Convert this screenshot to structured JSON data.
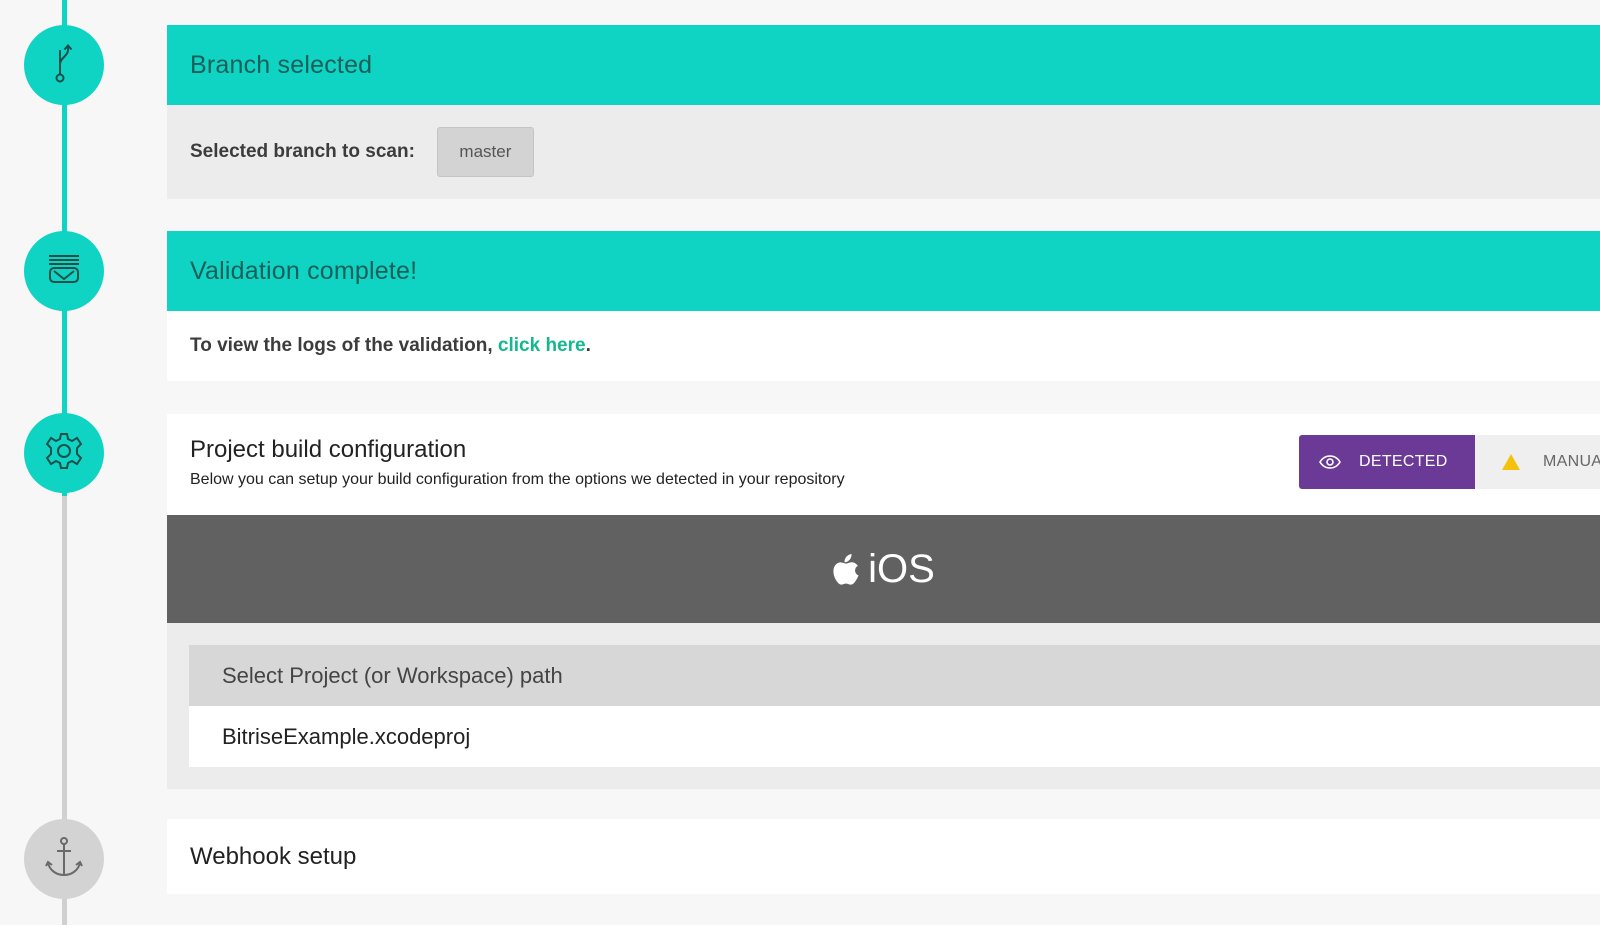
{
  "steps": {
    "branch": {
      "title": "Branch selected",
      "label": "Selected branch to scan:",
      "branch": "master"
    },
    "validation": {
      "title": "Validation complete!",
      "text_before": "To view the logs of the validation, ",
      "link": "click here",
      "text_after": "."
    },
    "config": {
      "title": "Project build configuration",
      "subtitle": "Below you can setup your build configuration from the options we detected in your repository",
      "mode_detected": "DETECTED",
      "mode_manual": "MANUAL",
      "platform": "iOS",
      "project_path_header": "Select Project (or Workspace) path",
      "project_path_option": "BitriseExample.xcodeproj"
    },
    "webhook": {
      "title": "Webhook setup"
    }
  },
  "colors": {
    "teal": "#0fd3c3",
    "purple": "#6b3a96",
    "link_green": "#13b98d",
    "ios_banner": "#616161",
    "warning_yellow": "#f4c20d"
  },
  "icons": [
    "branch-icon",
    "validation-icon",
    "gear-icon",
    "anchor-icon",
    "eye-icon",
    "warning-icon",
    "apple-icon"
  ]
}
